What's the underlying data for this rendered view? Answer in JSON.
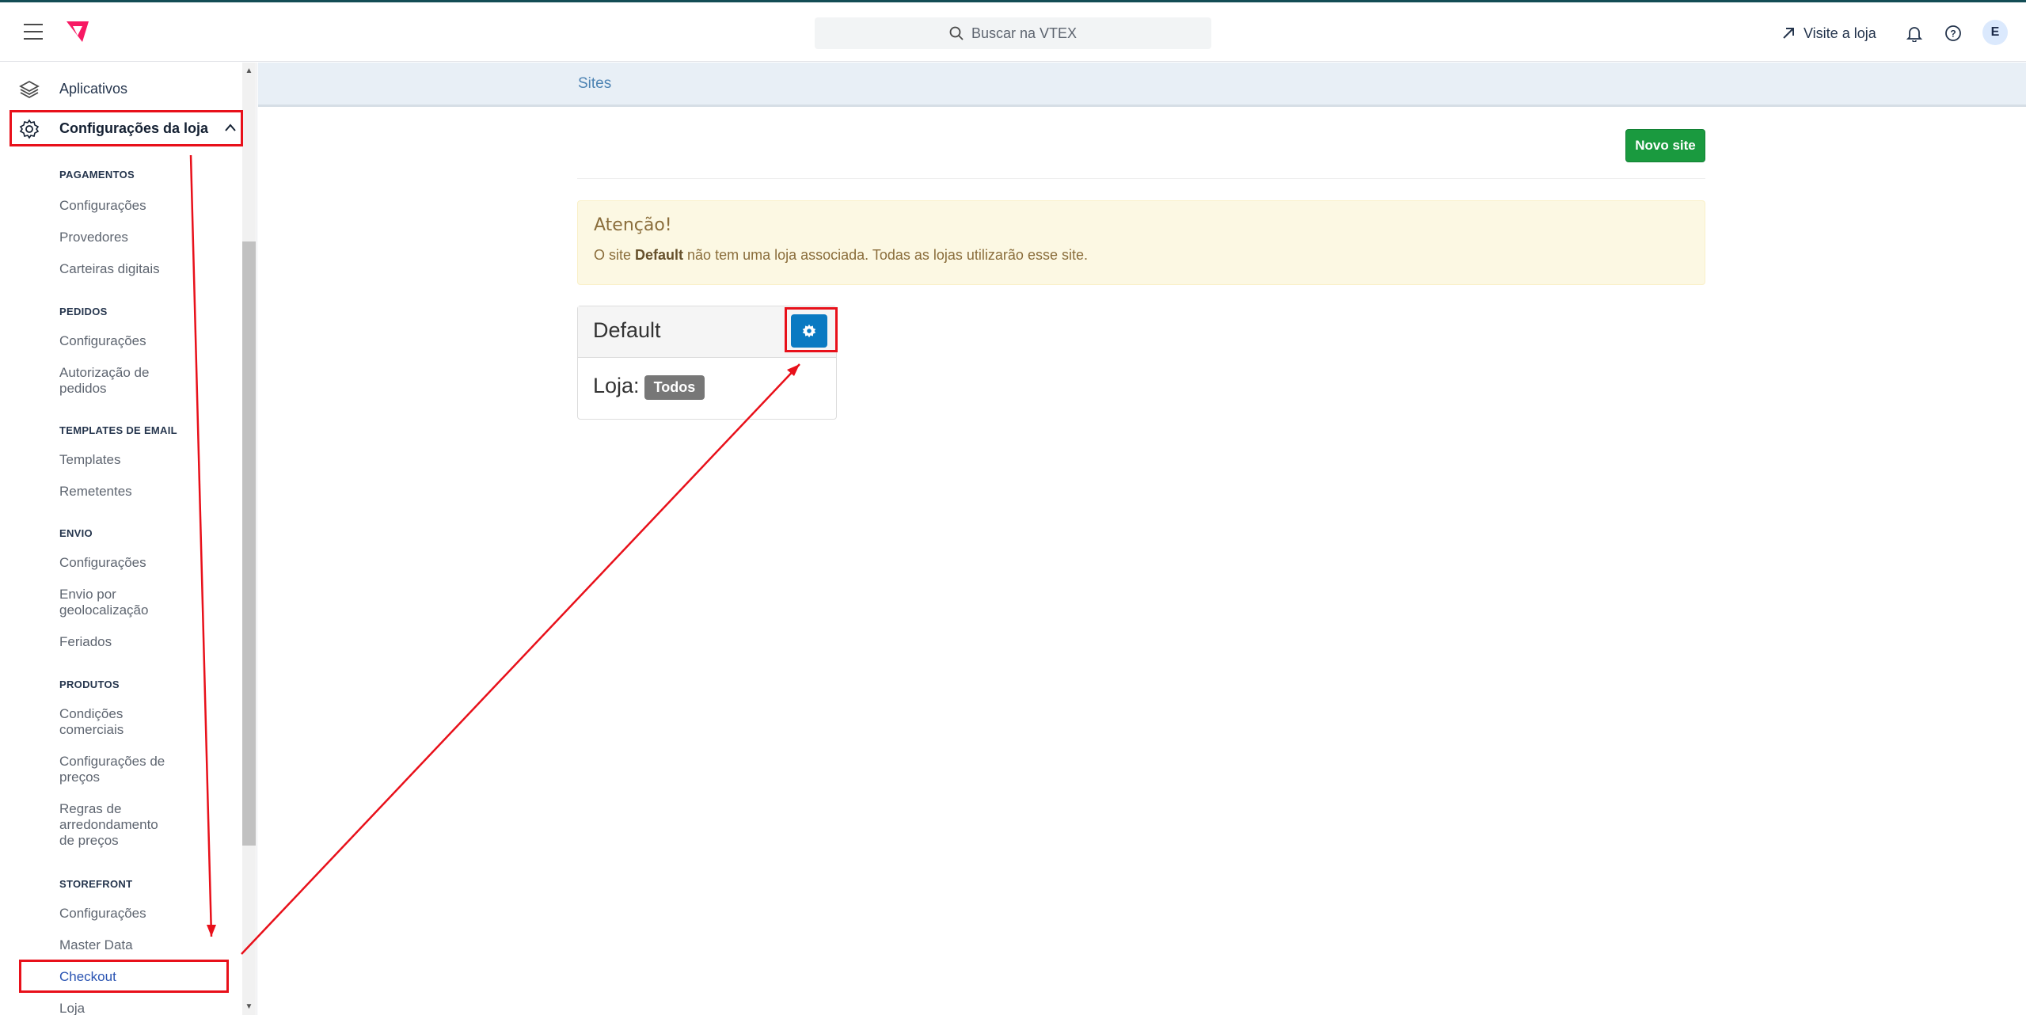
{
  "topbar": {
    "search_placeholder": "Buscar na VTEX",
    "visit_store": "Visite a loja",
    "avatar_initial": "E"
  },
  "sidebar": {
    "apps_label": "Aplicativos",
    "store_settings_label": "Configurações da loja",
    "sections": [
      {
        "title": "PAGAMENTOS",
        "items": [
          "Configurações",
          "Provedores",
          "Carteiras digitais"
        ]
      },
      {
        "title": "PEDIDOS",
        "items": [
          "Configurações",
          "Autorização de pedidos"
        ]
      },
      {
        "title": "TEMPLATES DE EMAIL",
        "items": [
          "Templates",
          "Remetentes"
        ]
      },
      {
        "title": "ENVIO",
        "items": [
          "Configurações",
          "Envio por geolocalização",
          "Feriados"
        ]
      },
      {
        "title": "PRODUTOS",
        "items": [
          "Condições comerciais",
          "Configurações de preços",
          "Regras de arredondamento de preços"
        ]
      },
      {
        "title": "STOREFRONT",
        "items": [
          "Configurações",
          "Master Data",
          "Checkout",
          "Loja"
        ]
      }
    ]
  },
  "main": {
    "page_title": "Sites",
    "new_site_button": "Novo site",
    "alert": {
      "heading": "Atenção!",
      "msg_prefix": "O site ",
      "msg_bold": "Default",
      "msg_suffix": " não tem uma loja associada. Todas as lojas utilizarão esse site."
    },
    "site_card": {
      "name": "Default",
      "store_label": "Loja:",
      "store_badge": "Todos"
    }
  },
  "colors": {
    "annotation": "#e8101a",
    "primary_button": "#0a7ac2",
    "success_button": "#1a9a3f",
    "logo": "#f71963"
  }
}
